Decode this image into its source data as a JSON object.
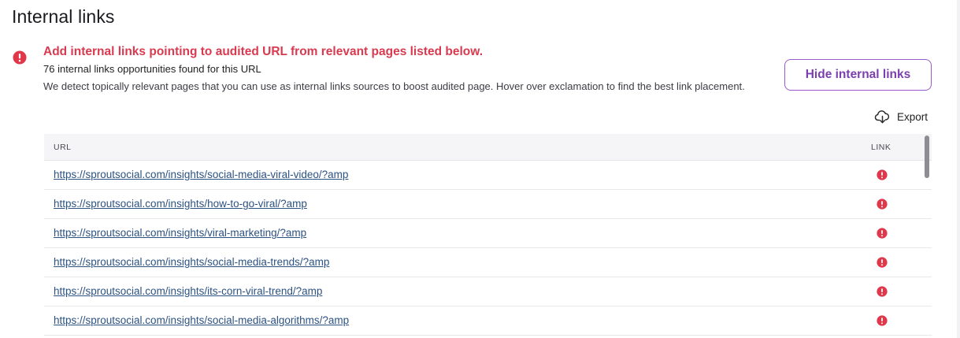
{
  "page": {
    "title": "Internal links"
  },
  "alert": {
    "icon": "exclamation-circle-icon",
    "heading": "Add internal links pointing to audited URL from relevant pages listed below.",
    "count_text": "76 internal links opportunities found for this URL",
    "description": "We detect topically relevant pages that you can use as internal links sources to boost audited page. Hover over exclamation to find the best link placement."
  },
  "actions": {
    "hide_label": "Hide internal links",
    "export_label": "Export",
    "export_icon": "cloud-download-icon"
  },
  "table": {
    "columns": {
      "url": "URL",
      "link": "LINK"
    },
    "row_icon": "exclamation-circle-icon",
    "rows": [
      {
        "url": "https://sproutsocial.com/insights/social-media-viral-video/?amp"
      },
      {
        "url": "https://sproutsocial.com/insights/how-to-go-viral/?amp"
      },
      {
        "url": "https://sproutsocial.com/insights/viral-marketing/?amp"
      },
      {
        "url": "https://sproutsocial.com/insights/social-media-trends/?amp"
      },
      {
        "url": "https://sproutsocial.com/insights/its-corn-viral-trend/?amp"
      },
      {
        "url": "https://sproutsocial.com/insights/social-media-algorithms/?amp"
      }
    ]
  },
  "colors": {
    "alert_red": "#d93a4f",
    "icon_red": "#e0374b",
    "accent_purple": "#7b3fb0",
    "link_blue": "#2c5282"
  }
}
